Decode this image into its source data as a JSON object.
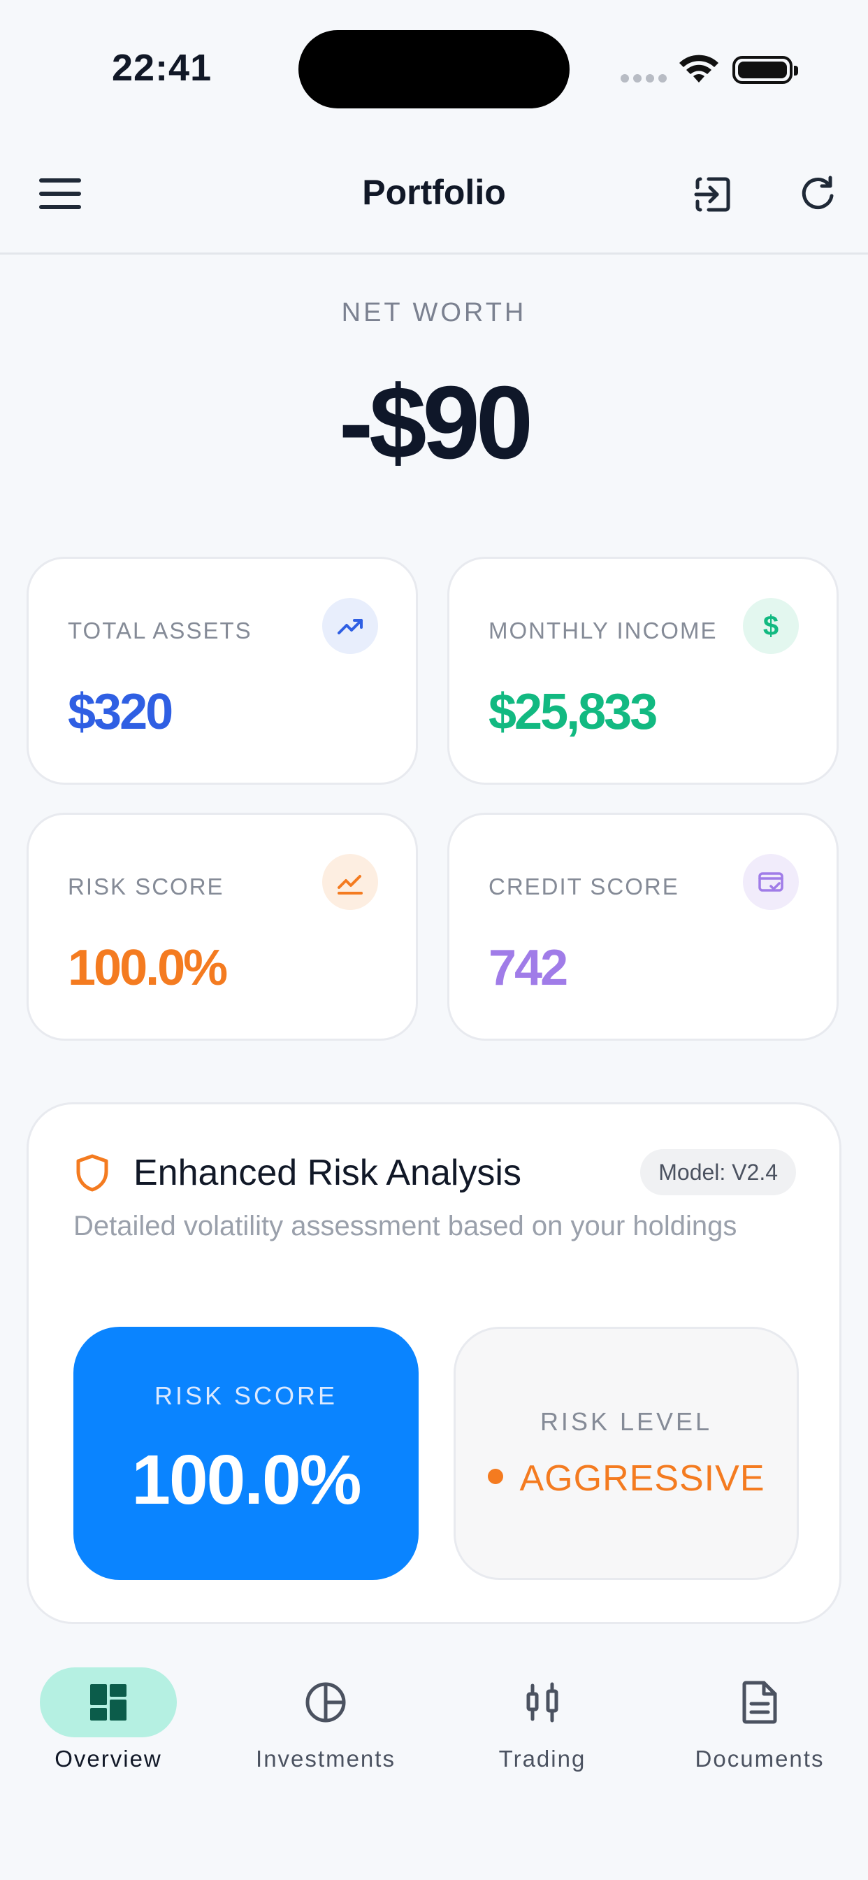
{
  "status_bar": {
    "time": "22:41"
  },
  "header": {
    "title": "Portfolio"
  },
  "net_worth": {
    "label": "NET WORTH",
    "value": "-$90"
  },
  "stats": [
    {
      "label": "TOTAL ASSETS",
      "value": "$320",
      "icon": "trending-up-icon",
      "color": "#2f5fe3",
      "icon_bg": "#e8eefc"
    },
    {
      "label": "MONTHLY INCOME",
      "value": "$25,833",
      "icon": "dollar-icon",
      "color": "#12b981",
      "icon_bg": "#e3f7ef"
    },
    {
      "label": "RISK SCORE",
      "value": "100.0%",
      "icon": "chart-up-icon",
      "color": "#f47b20",
      "icon_bg": "#fdeee1"
    },
    {
      "label": "CREDIT SCORE",
      "value": "742",
      "icon": "credit-card-icon",
      "color": "#a07ce8",
      "icon_bg": "#f1ecfb"
    }
  ],
  "risk_analysis": {
    "title": "Enhanced Risk Analysis",
    "model_badge": "Model: V2.4",
    "description": "Detailed volatility assessment based on your holdings",
    "score_label": "RISK SCORE",
    "score_value": "100.0%",
    "level_label": "RISK LEVEL",
    "level_value": "AGGRESSIVE"
  },
  "tabs": [
    {
      "label": "Overview",
      "icon": "dashboard-icon",
      "active": true
    },
    {
      "label": "Investments",
      "icon": "pie-chart-icon",
      "active": false
    },
    {
      "label": "Trading",
      "icon": "candlestick-icon",
      "active": false
    },
    {
      "label": "Documents",
      "icon": "document-icon",
      "active": false
    }
  ]
}
